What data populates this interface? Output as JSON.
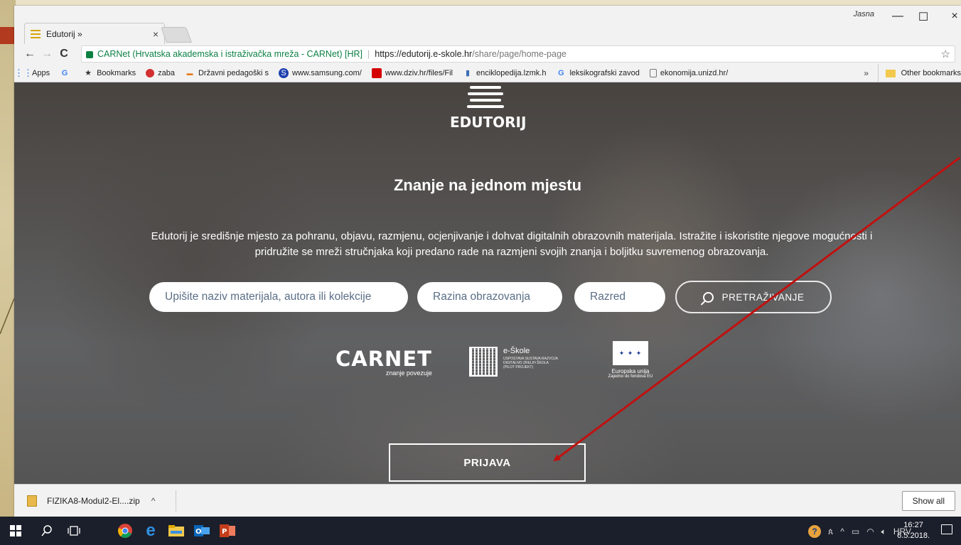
{
  "browser": {
    "tab_title": "Edutorij »",
    "tab_close": "×",
    "profile": "Jasna",
    "controls": {
      "minimize": "—",
      "maximize": "☐",
      "close": "×"
    },
    "nav": {
      "back": "←",
      "forward": "→",
      "reload": "C"
    },
    "address": {
      "secure_label": "CARNet (Hrvatska akademska i istraživačka mreža - CARNet) [HR]",
      "url_scheme_host": "https://edutorij.e-skole.hr",
      "url_path": "/share/page/home-page"
    },
    "star": "☆"
  },
  "bookmarks": {
    "items": [
      {
        "label": "Apps",
        "icon": "apps-grid-icon"
      },
      {
        "label": "",
        "icon": "google-icon"
      },
      {
        "label": "Bookmarks",
        "icon": "star-icon"
      },
      {
        "label": "zaba",
        "icon": "zaba-icon"
      },
      {
        "label": "Državni pedagoški s",
        "icon": "dps-icon"
      },
      {
        "label": "www.samsung.com/",
        "icon": "samsung-icon"
      },
      {
        "label": "www.dziv.hr/files/Fil",
        "icon": "dziv-icon"
      },
      {
        "label": "enciklopedija.lzmk.h",
        "icon": "lzmk-icon"
      },
      {
        "label": "leksikografski zavod",
        "icon": "google-icon"
      },
      {
        "label": "ekonomija.unizd.hr/",
        "icon": "page-icon"
      }
    ],
    "more": "»",
    "other": "Other bookmarks"
  },
  "page": {
    "logo_text": "EDUTORIJ",
    "headline": "Znanje na jednom mjestu",
    "description": "Edutorij je središnje mjesto za pohranu, objavu, razmjenu, ocjenjivanje i dohvat digitalnih obrazovnih materijala. Istražite i iskoristite njegove mogućnosti i pridružite se mreži stručnjaka koji predano rade na razmjeni svojih znanja i boljitku suvremenog obrazovanja.",
    "search": {
      "query_placeholder": "Upišite naziv materijala, autora ili kolekcije",
      "level_placeholder": "Razina obrazovanja",
      "grade_placeholder": "Razred",
      "button": "PRETRAŽIVANJE"
    },
    "partners": {
      "carnet_name": "CARNET",
      "carnet_tagline": "znanje povezuje",
      "eskole_name": "e-Škole",
      "eskole_sub": "USPOSTAVA SUSTAVA RAZVOJA DIGITALNO ZRELIH ŠKOLA (PILOT PROJEKT)",
      "eu_name": "Europska unija",
      "eu_sub": "Zajedno do fondova EU"
    },
    "login_button": "PRIJAVA"
  },
  "downloads": {
    "file": "FIZIKA8-Modul2-El....zip",
    "caret": "^",
    "show_all": "Show all"
  },
  "taskbar": {
    "language": "HRV",
    "time": "16:27",
    "date": "6.5.2018."
  },
  "colors": {
    "annotation_red": "#c0110f",
    "secure_green": "#0b8043"
  }
}
